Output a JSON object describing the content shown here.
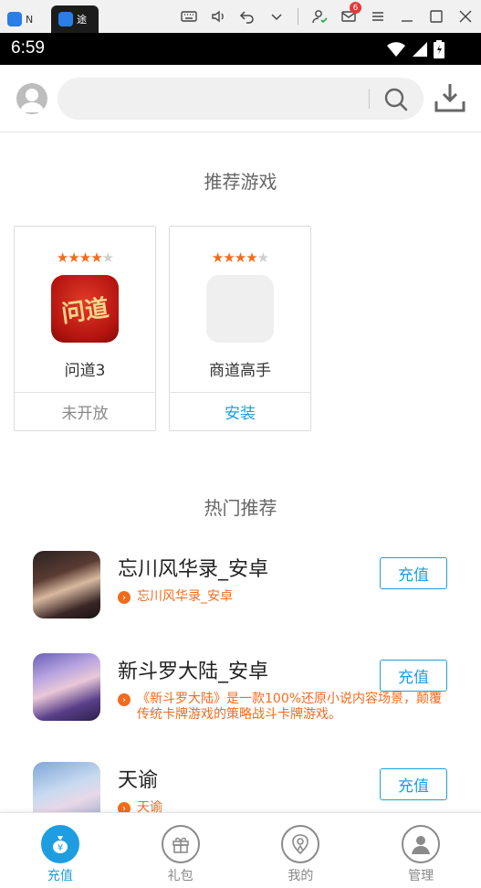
{
  "emulator": {
    "tab1_label": "N",
    "tab2_label": "途",
    "mail_badge": "6"
  },
  "status": {
    "time": "6:59"
  },
  "search": {
    "placeholder": ""
  },
  "recommended": {
    "title": "推荐游戏",
    "games": [
      {
        "name": "问道3",
        "rating": 4,
        "action": "未开放",
        "icon_text": "问道"
      },
      {
        "name": "商道高手",
        "rating": 4,
        "action": "安装"
      }
    ]
  },
  "hot": {
    "title": "热门推荐",
    "items": [
      {
        "title": "忘川风华录_安卓",
        "desc": "忘川风华录_安卓",
        "button": "充值"
      },
      {
        "title": "新斗罗大陆_安卓",
        "desc": "《新斗罗大陆》是一款100%还原小说内容场景，颠覆传统卡牌游戏的策略战斗卡牌游戏。",
        "button": "充值"
      },
      {
        "title": "天谕",
        "desc": "天谕",
        "button": "充值"
      }
    ]
  },
  "nav": {
    "items": [
      {
        "label": "充值",
        "icon": "yen-bag-icon"
      },
      {
        "label": "礼包",
        "icon": "gift-icon"
      },
      {
        "label": "我的",
        "icon": "user-shield-icon"
      },
      {
        "label": "管理",
        "icon": "person-icon"
      }
    ]
  },
  "colors": {
    "accent": "#1e9ee0",
    "orange": "#f26b1d"
  }
}
